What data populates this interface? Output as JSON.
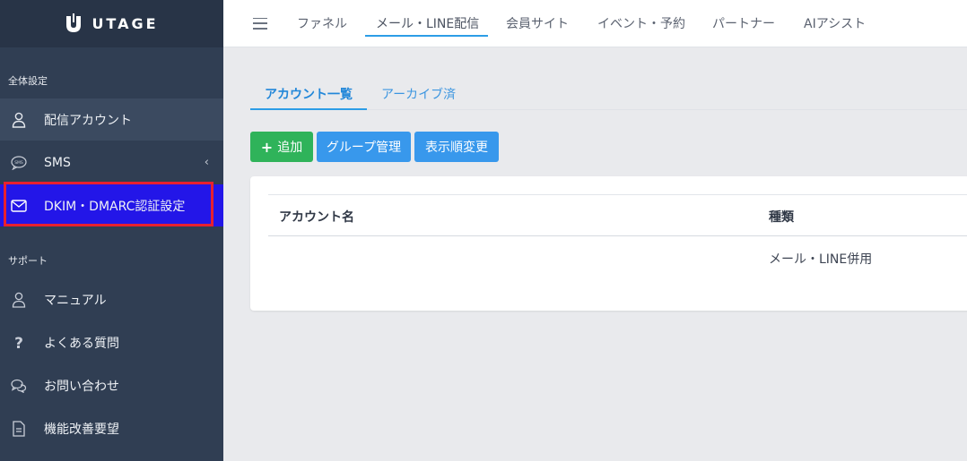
{
  "brand": {
    "name": "UTAGE"
  },
  "sidebar": {
    "sections": [
      {
        "label": "全体設定"
      },
      {
        "label": "サポート"
      }
    ],
    "items": [
      {
        "label": "配信アカウント",
        "icon": "user-icon"
      },
      {
        "label": "SMS",
        "icon": "sms-chat-icon"
      },
      {
        "label": "DKIM・DMARC認証設定",
        "icon": "mail-icon"
      },
      {
        "label": "マニュアル",
        "icon": "user-outline-icon"
      },
      {
        "label": "よくある質問",
        "icon": "question-icon"
      },
      {
        "label": "お問い合わせ",
        "icon": "chat-bubbles-icon"
      },
      {
        "label": "機能改善要望",
        "icon": "document-icon"
      }
    ]
  },
  "topnav": {
    "items": [
      {
        "label": "ファネル"
      },
      {
        "label": "メール・LINE配信"
      },
      {
        "label": "会員サイト"
      },
      {
        "label": "イベント・予約"
      },
      {
        "label": "パートナー"
      },
      {
        "label": "AIアシスト"
      }
    ]
  },
  "tabs": [
    {
      "label": "アカウント一覧"
    },
    {
      "label": "アーカイブ済"
    }
  ],
  "buttons": {
    "add": "追加",
    "group": "グループ管理",
    "order": "表示順変更"
  },
  "table": {
    "headers": [
      "アカウント名",
      "種類"
    ],
    "rows": [
      [
        "",
        "メール・LINE併用"
      ]
    ]
  },
  "colors": {
    "sidebar_bg": "#303e53",
    "selected_item": "#2316e8",
    "highlight_border": "#e8202e",
    "accent_blue": "#3898ec",
    "add_green": "#2fb35a"
  }
}
